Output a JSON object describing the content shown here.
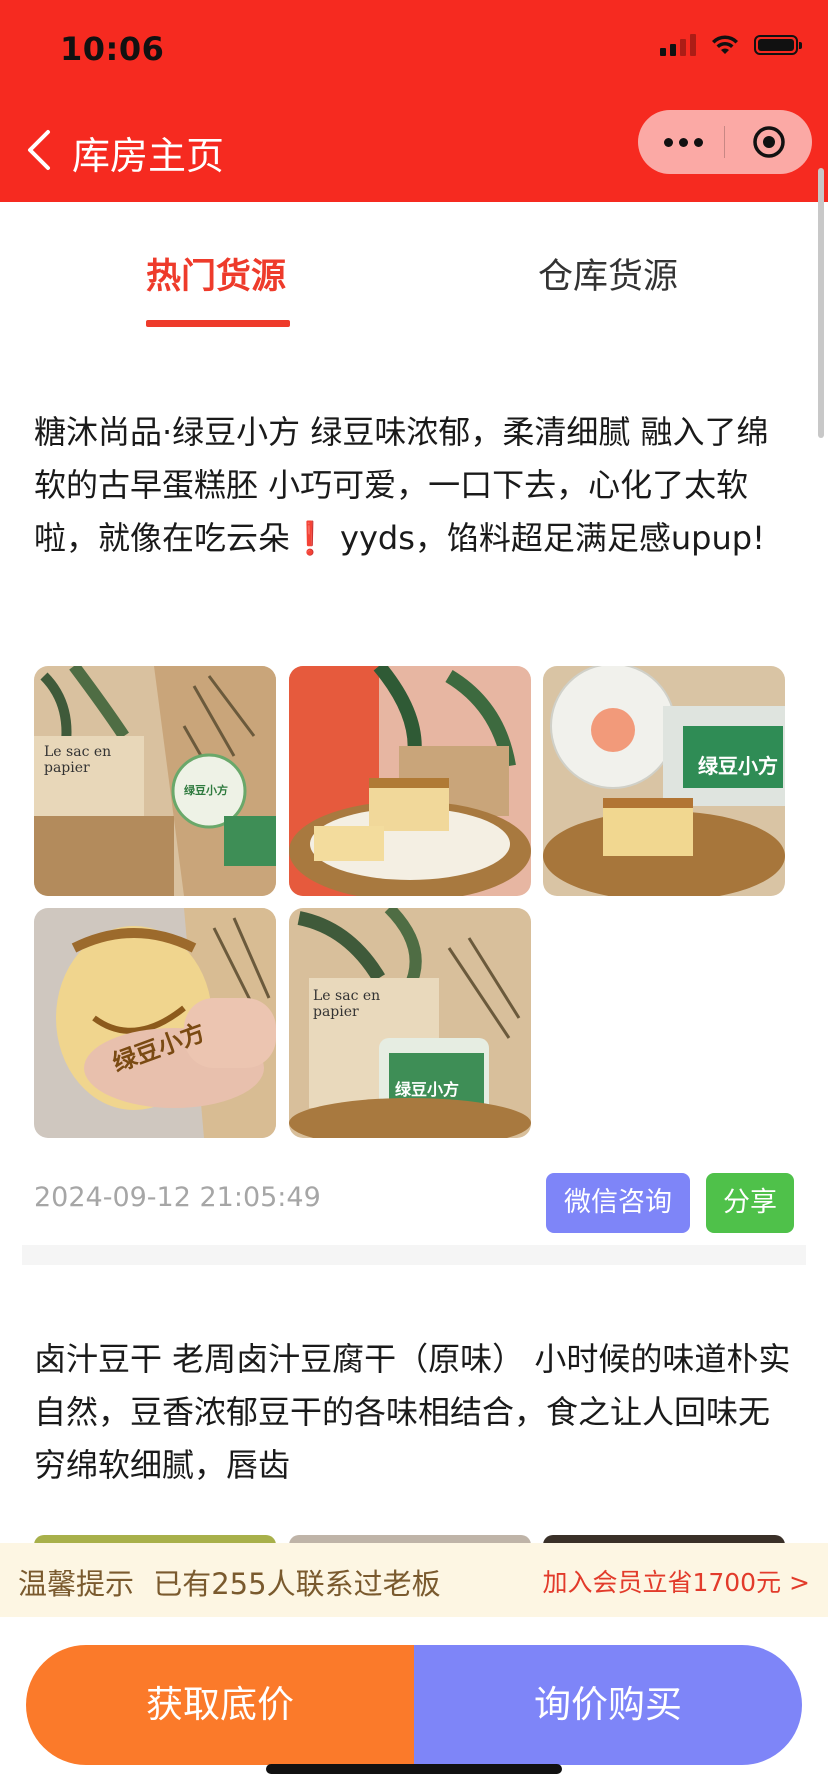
{
  "status_bar": {
    "time": "10:06"
  },
  "nav": {
    "title": "库房主页"
  },
  "tabs": [
    {
      "label": "热门货源",
      "active": true
    },
    {
      "label": "仓库货源",
      "active": false
    }
  ],
  "posts": [
    {
      "text": "糖沐尚品·绿豆小方 绿豆味浓郁，柔清细腻  融入了绵软的古早蛋糕胚 小巧可爱，一口下去，心化了太软啦，就像在吃云朵❗ yyds，馅料超足满足感upup!",
      "images": [
        {
          "label_top": "Le sac en papier",
          "label_badge": "绿豆小方",
          "tone": "kraft"
        },
        {
          "label_top": "",
          "label_badge": "",
          "tone": "cake"
        },
        {
          "label_top": "",
          "label_badge": "绿豆小方",
          "tone": "green"
        },
        {
          "label_top": "",
          "label_badge": "绿豆小方",
          "tone": "hand"
        },
        {
          "label_top": "Le sac en papier",
          "label_badge": "绿豆小方",
          "tone": "kraft"
        }
      ],
      "timestamp": "2024-09-12 21:05:49",
      "wechat_button": "微信咨询",
      "share_button": "分享"
    },
    {
      "text": "卤汁豆干 老周卤汁豆腐干（原味） 小时候的味道朴实自然，豆香浓郁豆干的各味相结合，食之让人回味无穷绵软细腻，唇齿"
    }
  ],
  "tip": {
    "label": "温馨提示",
    "message": "已有255人联系过老板",
    "promo": "加入会员立省1700元 >"
  },
  "actions": {
    "lowest_price": "获取底价",
    "inquire_buy": "询价购买"
  },
  "colors": {
    "brand_red": "#f62a20",
    "tab_active": "#ee3b2b",
    "wechat_btn": "#7e85f8",
    "share_btn": "#4fc14a",
    "orange": "#fb7a2a",
    "indigo": "#7e85f8"
  }
}
